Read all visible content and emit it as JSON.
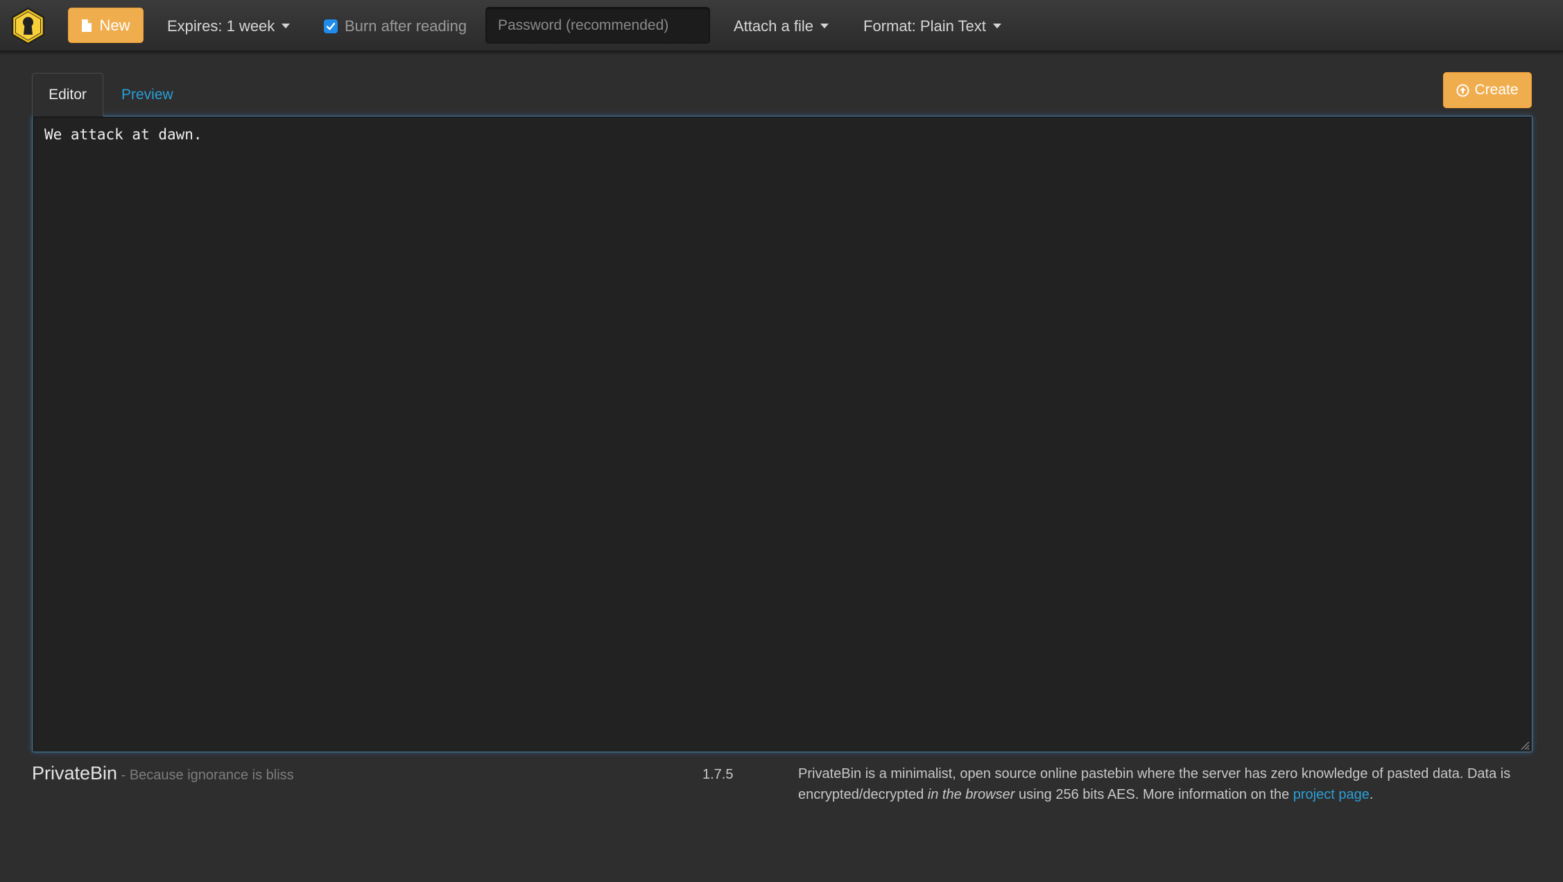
{
  "navbar": {
    "new_label": "New",
    "expires_label": "Expires: 1 week",
    "burn_label": "Burn after reading",
    "burn_checked": true,
    "password_placeholder": "Password (recommended)",
    "attach_label": "Attach a file",
    "format_label": "Format: Plain Text"
  },
  "tabs": {
    "editor": "Editor",
    "preview": "Preview"
  },
  "create_label": "Create",
  "editor_text": "We attack at dawn.",
  "footer": {
    "brand": "PrivateBin",
    "tagline": " - Because ignorance is bliss",
    "version": "1.7.5",
    "about_part1": "PrivateBin is a minimalist, open source online pastebin where the server has zero knowledge of pasted data. Data is encrypted/decrypted ",
    "about_italic": "in the browser",
    "about_part2": " using 256 bits AES. More information on the ",
    "about_link": "project page",
    "about_end": "."
  },
  "colors": {
    "accent": "#f0ad4e",
    "link": "#2a9fd6",
    "checkbox": "#1f8ceb",
    "background": "#2e2e2f"
  }
}
